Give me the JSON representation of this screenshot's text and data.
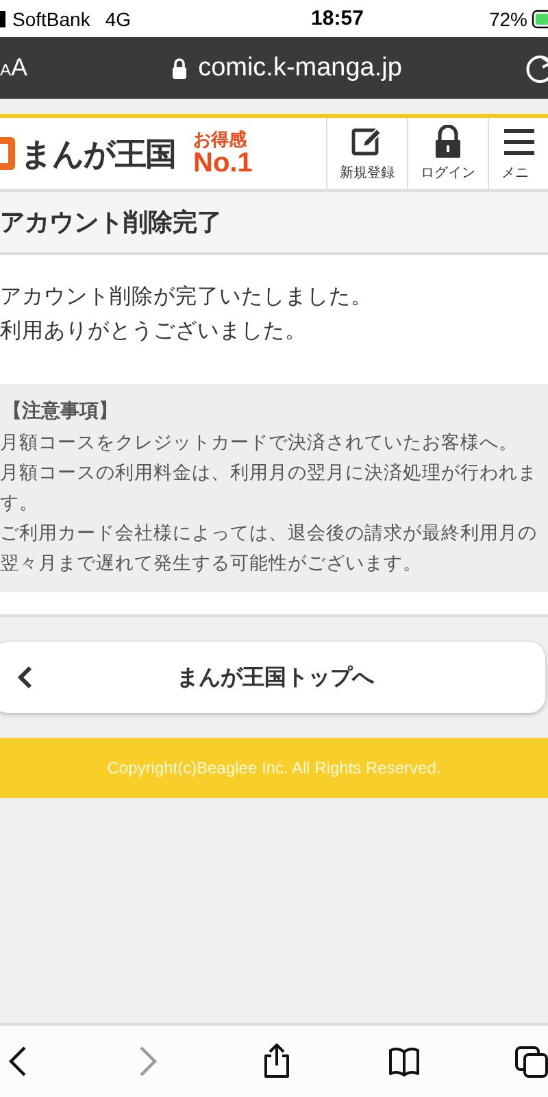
{
  "status_bar": {
    "carrier": "SoftBank",
    "network": "4G",
    "time": "18:57",
    "battery": "72%"
  },
  "address_bar": {
    "text_size": "AA",
    "url": "comic.k-manga.jp"
  },
  "header": {
    "logo": "まんが王国",
    "badge_top": "お得感",
    "badge_bottom": "No.1",
    "nav": [
      {
        "label": "新規登録",
        "kind": "pencil"
      },
      {
        "label": "ログイン",
        "kind": "lock"
      },
      {
        "label": "メニ",
        "kind": "menu"
      }
    ]
  },
  "page_title": "アカウント削除完了",
  "messages": [
    "アカウント削除が完了いたしました。",
    "利用ありがとうございました。"
  ],
  "notice": {
    "heading": "【注意事項】",
    "lines": [
      "月額コースをクレジットカードで決済されていたお客様へ。",
      "月額コースの利用料金は、利用月の翌月に決済処理が行われます。",
      "ご利用カード会社様によっては、退会後の請求が最終利用月の翌々月まで遅れて発生する可能性がございます。"
    ]
  },
  "top_button": {
    "label": "まんが王国トップへ"
  },
  "footer": "Copyright(c)Beaglee Inc. All Rights Reserved.",
  "toolbar": [
    {
      "kind": "back",
      "disabled": false
    },
    {
      "kind": "forward",
      "disabled": true
    },
    {
      "kind": "share",
      "disabled": false
    },
    {
      "kind": "bookmarks",
      "disabled": false
    },
    {
      "kind": "tabs",
      "disabled": false
    }
  ]
}
